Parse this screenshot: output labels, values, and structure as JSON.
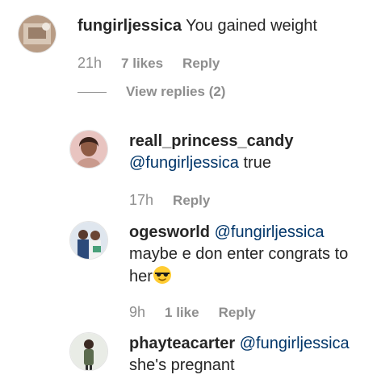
{
  "comments": [
    {
      "username": "fungirljessica",
      "text": "You gained weight",
      "time": "21h",
      "likes": "7 likes",
      "reply": "Reply",
      "view_replies": "View replies (2)",
      "avatar_icon": "user-avatar-photo"
    }
  ],
  "replies": [
    {
      "username": "reall_princess_candy",
      "mention": "@fungirljessica",
      "text": " true",
      "time": "17h",
      "reply": "Reply",
      "avatar_icon": "user-avatar-photo"
    },
    {
      "username": "ogesworld",
      "mention": "@fungirljessica",
      "text_line2": "maybe e don enter congrats to",
      "text_line3": "her",
      "emoji": "sunglasses-emoji",
      "time": "9h",
      "likes": "1 like",
      "reply": "Reply",
      "avatar_icon": "user-avatar-photo"
    },
    {
      "username": "phayteacarter",
      "mention": "@fungirljessica",
      "text_line2": "she's pregnant",
      "avatar_icon": "user-avatar-photo"
    }
  ],
  "colors": {
    "text": "#262626",
    "meta": "#8e8e8e",
    "mention": "#003569"
  }
}
